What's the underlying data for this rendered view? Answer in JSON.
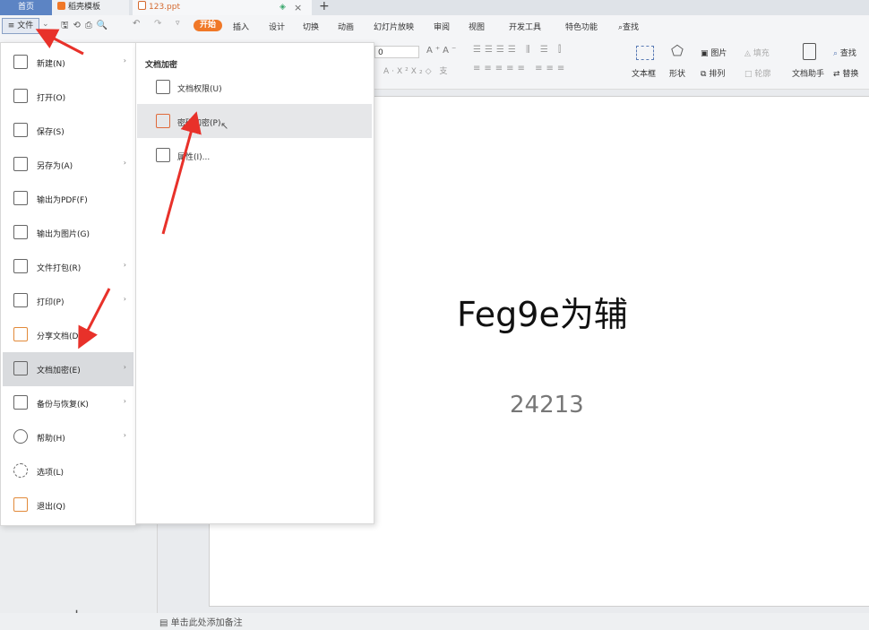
{
  "tabs": [
    {
      "label": "首页"
    },
    {
      "label": "稻壳模板"
    },
    {
      "label": "123.ppt"
    }
  ],
  "tab_controls": {
    "close": "×",
    "add": "+"
  },
  "toolbar": {
    "file_label": "文件",
    "start_label": "开始",
    "menus": [
      "插入",
      "设计",
      "切换",
      "动画",
      "幻灯片放映",
      "审阅",
      "视图",
      "开发工具",
      "特色功能"
    ],
    "search_label": "查找",
    "font_size_value": "0",
    "right_labels": {
      "textbox": "文本框",
      "shape": "形状",
      "picture": "图片",
      "arrange": "排列",
      "fill": "填充",
      "outline": "轮廓",
      "assistant": "文档助手",
      "find": "查找",
      "replace": "替换"
    }
  },
  "file_menu": {
    "items": [
      {
        "label": "新建(N)",
        "submenu": true
      },
      {
        "label": "打开(O)",
        "submenu": false
      },
      {
        "label": "保存(S)",
        "submenu": false
      },
      {
        "label": "另存为(A)",
        "submenu": true
      },
      {
        "label": "输出为PDF(F)",
        "submenu": false
      },
      {
        "label": "输出为图片(G)",
        "submenu": false
      },
      {
        "label": "文件打包(R)",
        "submenu": true
      },
      {
        "label": "打印(P)",
        "submenu": true
      },
      {
        "label": "分享文档(D)",
        "submenu": false
      },
      {
        "label": "文档加密(E)",
        "submenu": true,
        "active": true
      },
      {
        "label": "备份与恢复(K)",
        "submenu": true
      },
      {
        "label": "帮助(H)",
        "submenu": true
      },
      {
        "label": "选项(L)",
        "submenu": false
      },
      {
        "label": "退出(Q)",
        "submenu": false
      }
    ]
  },
  "submenu": {
    "title": "文档加密",
    "items": [
      {
        "label": "文档权限(U)"
      },
      {
        "label": "密码加密(P)",
        "hover": true
      },
      {
        "label": "属性(I)..."
      }
    ]
  },
  "slide": {
    "title": "Feg9e为辅",
    "subtitle": "24213"
  },
  "notes_placeholder": "单击此处添加备注",
  "add_slide": "+",
  "colors": {
    "accent": "#f07828",
    "arrow": "#e8312a",
    "home_tab": "#5c84c4"
  }
}
